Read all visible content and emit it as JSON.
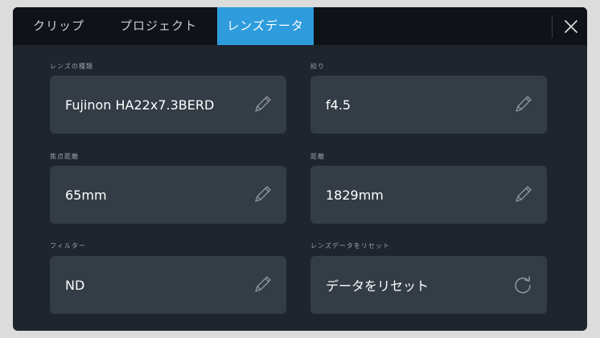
{
  "tabs": [
    {
      "label": "クリップ",
      "active": false
    },
    {
      "label": "プロジェクト",
      "active": false
    },
    {
      "label": "レンズデータ",
      "active": true
    }
  ],
  "close_icon": "close-icon",
  "accent_color": "#2e9bdc",
  "fields": {
    "lens_type": {
      "label": "レンズの種類",
      "value": "Fujinon HA22x7.3BERD",
      "icon": "pencil-icon"
    },
    "iris": {
      "label": "絞り",
      "value": "f4.5",
      "icon": "pencil-icon"
    },
    "focal_length": {
      "label": "焦点距離",
      "value": "65mm",
      "icon": "pencil-icon"
    },
    "distance": {
      "label": "距離",
      "value": "1829mm",
      "icon": "pencil-icon"
    },
    "filter": {
      "label": "フィルター",
      "value": "ND",
      "icon": "pencil-icon"
    },
    "reset": {
      "label": "レンズデータをリセット",
      "value": "データをリセット",
      "icon": "reset-icon"
    }
  }
}
